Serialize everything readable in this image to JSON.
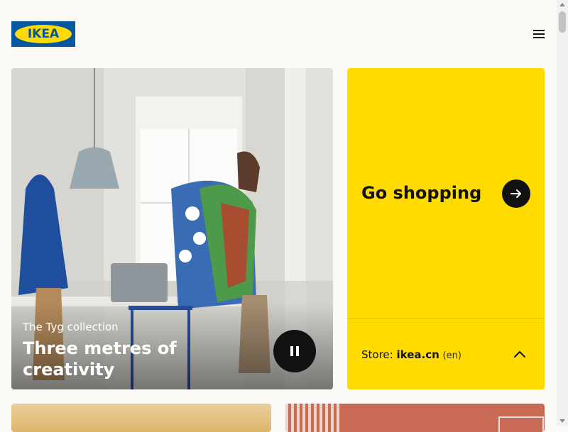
{
  "brand": {
    "logo_text": "IKEA",
    "blue": "#0058a3",
    "yellow": "#ffdb00"
  },
  "header": {
    "menu_icon": "hamburger-icon"
  },
  "hero": {
    "subtitle": "The Tyg collection",
    "title": "Three metres of creativity",
    "control_icon": "pause-icon"
  },
  "promo": {
    "title": "Go shopping",
    "arrow_icon": "arrow-right-icon",
    "store_label": "Store:",
    "store_domain": "ikea.cn",
    "store_lang": "(en)",
    "chevron_icon": "chevron-up-icon"
  }
}
